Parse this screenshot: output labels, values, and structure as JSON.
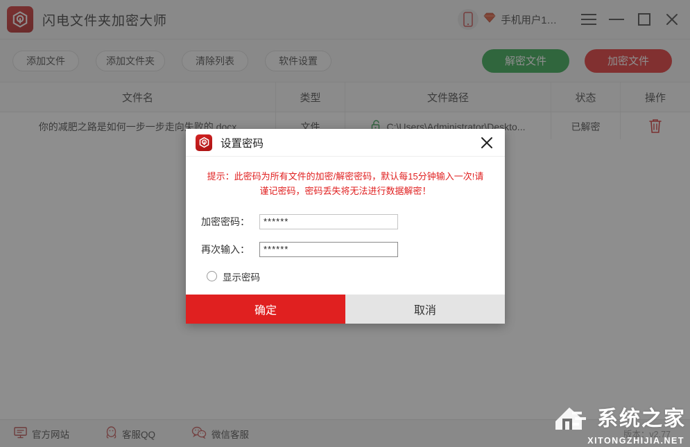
{
  "titlebar": {
    "app_name": "闪电文件夹加密大师",
    "logo_icon": "app-shield-logo-icon",
    "phone_icon": "phone-icon",
    "vip_icon": "vip-diamond-icon",
    "user_name": "手机用户1…",
    "menu_icon": "hamburger-menu-icon",
    "minimize_icon": "minimize-icon",
    "maximize_icon": "maximize-icon",
    "close_icon": "close-icon"
  },
  "toolbar": {
    "add_file": "添加文件",
    "add_folder": "添加文件夹",
    "clear_list": "清除列表",
    "settings": "软件设置",
    "decrypt": "解密文件",
    "encrypt": "加密文件",
    "decrypt_color": "#21a03f",
    "encrypt_color": "#e02020"
  },
  "table": {
    "headers": [
      "文件名",
      "类型",
      "文件路径",
      "状态",
      "操作"
    ],
    "rows": [
      {
        "name": "你的减肥之路是如何一步一步走向失败的.docx",
        "type": "文件",
        "path_icon": "unlock-icon",
        "path": "C:\\Users\\Administrator\\Deskto...",
        "status": "已解密",
        "delete_icon": "trash-icon"
      }
    ]
  },
  "statusbar": {
    "links": [
      {
        "label": "官方网站",
        "icon": "monitor-icon"
      },
      {
        "label": "客服QQ",
        "icon": "qq-penguin-icon"
      },
      {
        "label": "微信客服",
        "icon": "wechat-icon"
      }
    ],
    "version": "版本：v2.77"
  },
  "watermark": {
    "title": "系统之家",
    "url": "XITONGZHIJIA.NET",
    "logo_icon": "watermark-logo-icon"
  },
  "dialog": {
    "icon": "app-shield-logo-icon",
    "title": "设置密码",
    "close_icon": "close-icon",
    "warning": "提示：此密码为所有文件的加密/解密密码，默认每15分钟输入一次!请谨记密码，密码丢失将无法进行数据解密！",
    "fields": [
      {
        "label": "加密密码：",
        "value": "******"
      },
      {
        "label": "再次输入：",
        "value": "******"
      }
    ],
    "show_password_label": "显示密码",
    "ok": "确定",
    "cancel": "取消"
  }
}
